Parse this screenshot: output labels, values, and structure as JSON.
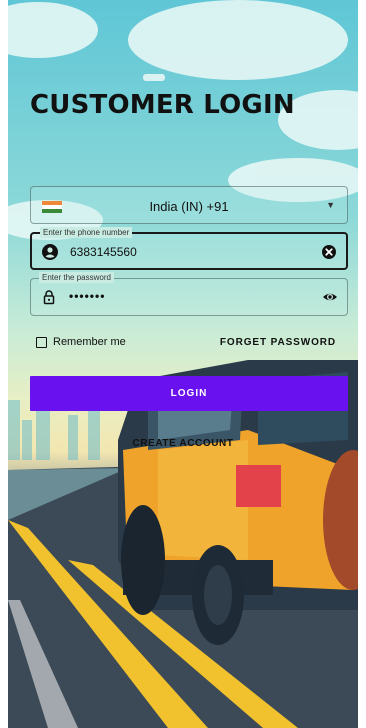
{
  "title": "CUSTOMER LOGIN",
  "country": {
    "label": "India (IN)  +91",
    "flag_colors": [
      "#f0883a",
      "#ffffff",
      "#3a8a3a"
    ],
    "icon": "chevron-down-icon"
  },
  "phone": {
    "label": "Enter the phone number",
    "value": "6383145560",
    "lead_icon": "user-icon",
    "trail_icon": "clear-icon"
  },
  "password": {
    "label": "Enter the password",
    "value": "•••••••",
    "lead_icon": "lock-icon",
    "trail_icon": "eye-icon"
  },
  "remember_me": {
    "label": "Remember me",
    "checked": false
  },
  "forget_password": "FORGET PASSWORD",
  "login_button": "LOGIN",
  "create_account": "CREATE ACCOUNT",
  "colors": {
    "primary": "#6a11f0",
    "text": "#111111"
  }
}
